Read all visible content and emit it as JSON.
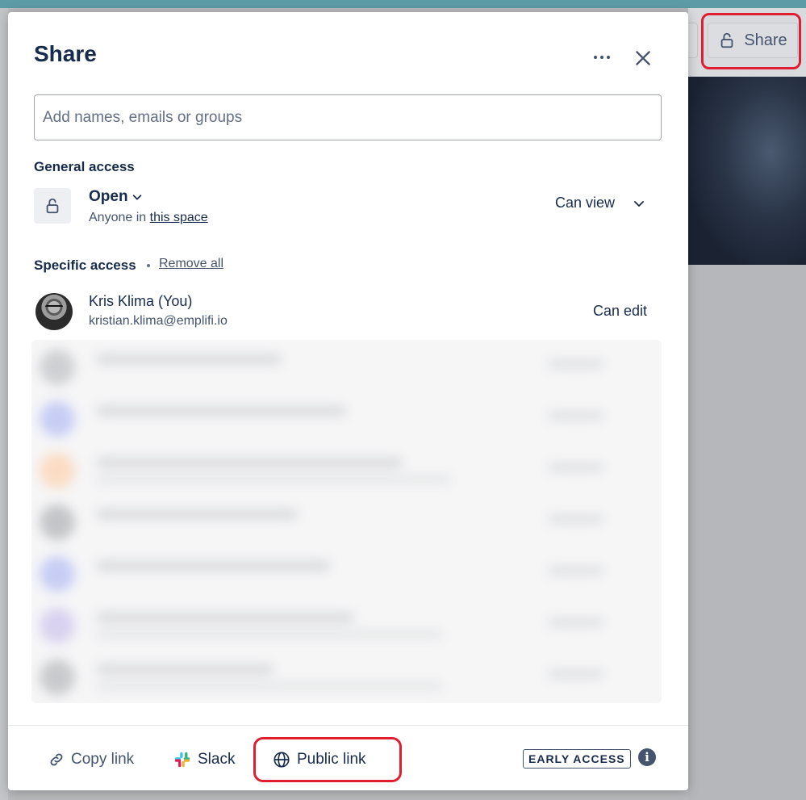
{
  "top_button": {
    "label": "Share"
  },
  "modal": {
    "title": "Share",
    "search": {
      "placeholder": "Add names, emails or groups",
      "value": ""
    },
    "general_access": {
      "heading": "General access",
      "level": "Open",
      "description_prefix": "Anyone in",
      "description_link": "this space",
      "permission": "Can view"
    },
    "specific_access": {
      "heading": "Specific access",
      "remove_all": "Remove all",
      "users": [
        {
          "name": "Kris Klima (You)",
          "email": "kristian.klima@emplifi.io",
          "permission": "Can edit"
        }
      ]
    },
    "footer": {
      "copy_link": "Copy link",
      "slack": "Slack",
      "public_link": "Public link",
      "badge": "EARLY ACCESS",
      "info": "i"
    }
  },
  "colors": {
    "highlight": "#e01e2f",
    "text_primary": "#172b4d",
    "text_subtle": "#44546f",
    "topstrip": "#5d9ba6"
  }
}
